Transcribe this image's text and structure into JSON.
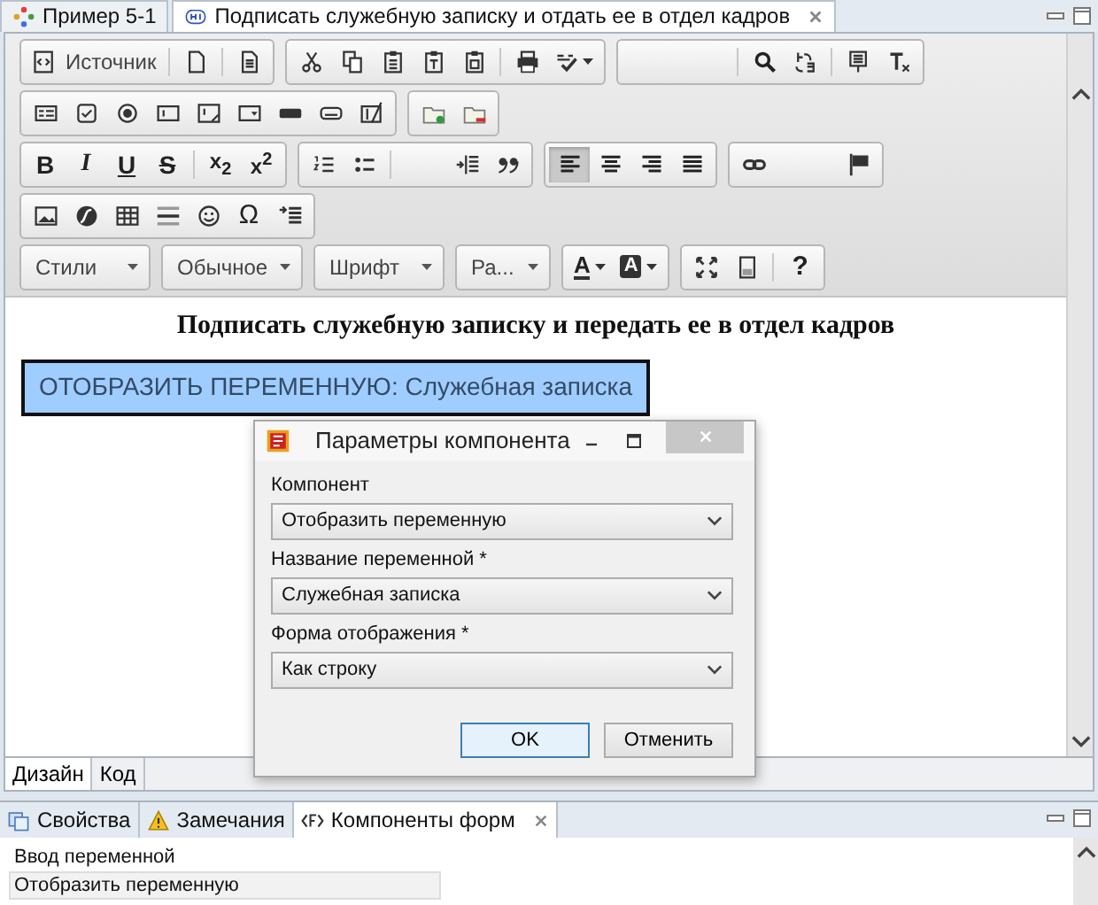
{
  "editor_tabs": [
    {
      "label": "Пример 5-1",
      "selected": false,
      "closable": false
    },
    {
      "label": "Подписать служебную записку и отдать ее в отдел кадров",
      "selected": true,
      "closable": true
    }
  ],
  "toolbar": {
    "source_label": "Источник",
    "format_buttons": [
      {
        "label": "B"
      },
      {
        "label": "I"
      },
      {
        "label": "U"
      },
      {
        "label": "S"
      }
    ],
    "script_buttons": [
      {
        "label": "x$_{2}$"
      },
      {
        "label": "x$^{2}$"
      }
    ],
    "align_buttons": [
      {
        "selected": true
      },
      {
        "selected": false
      },
      {
        "selected": false
      },
      {
        "selected": false
      }
    ],
    "special_char": "Ω",
    "dropdowns": [
      "Стили",
      "Обычное",
      "Шрифт",
      "Ра..."
    ],
    "color_buttons": [
      {
        "label": "A",
        "kind": "text"
      },
      {
        "label": "A",
        "kind": "background"
      }
    ],
    "help": "?"
  },
  "document": {
    "heading": "Подписать служебную записку и передать ее в отдел кадров",
    "variable_block": "ОТОБРАЗИТЬ ПЕРЕМЕННУЮ: Служебная записка"
  },
  "dialog": {
    "title": "Параметры компонента",
    "fields": [
      {
        "label": "Компонент",
        "value": "Отобразить переменную"
      },
      {
        "label": "Название переменной *",
        "value": "Служебная записка"
      },
      {
        "label": "Форма отображения *",
        "value": "Как строку"
      }
    ],
    "buttons": [
      {
        "label": "OK",
        "default": true
      },
      {
        "label": "Отменить",
        "default": false
      }
    ]
  },
  "view_tabs": [
    {
      "label": "Дизайн",
      "selected": true
    },
    {
      "label": "Код",
      "selected": false
    }
  ],
  "bottom_panel": {
    "tabs": [
      {
        "label": "Свойства",
        "selected": false,
        "closable": false
      },
      {
        "label": "Замечания",
        "selected": false,
        "closable": false
      },
      {
        "label": "Компоненты форм",
        "selected": true,
        "closable": true
      }
    ],
    "items": [
      {
        "label": "Ввод переменной",
        "selected": false
      },
      {
        "label": "Отобразить переменную",
        "selected": true
      }
    ]
  }
}
